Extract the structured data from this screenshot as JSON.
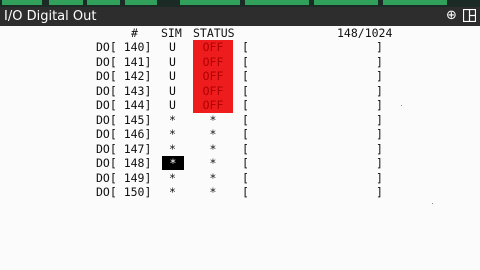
{
  "window": {
    "title": "I/O Digital Out"
  },
  "header": {
    "col_num": "#",
    "col_sim": "SIM",
    "col_status": "STATUS",
    "position": "148/1024"
  },
  "rows": [
    {
      "label": "DO[ 140]",
      "sim": "U",
      "status": "OFF",
      "lb": "[",
      "rb": "]"
    },
    {
      "label": "DO[ 141]",
      "sim": "U",
      "status": "OFF",
      "lb": "[",
      "rb": "]"
    },
    {
      "label": "DO[ 142]",
      "sim": "U",
      "status": "OFF",
      "lb": "[",
      "rb": "]"
    },
    {
      "label": "DO[ 143]",
      "sim": "U",
      "status": "OFF",
      "lb": "[",
      "rb": "]"
    },
    {
      "label": "DO[ 144]",
      "sim": "U",
      "status": "OFF",
      "lb": "[",
      "rb": "]"
    },
    {
      "label": "DO[ 145]",
      "sim": "*",
      "status": "*",
      "lb": "[",
      "rb": "]"
    },
    {
      "label": "DO[ 146]",
      "sim": "*",
      "status": "*",
      "lb": "[",
      "rb": "]"
    },
    {
      "label": "DO[ 147]",
      "sim": "*",
      "status": "*",
      "lb": "[",
      "rb": "]"
    },
    {
      "label": "DO[ 148]",
      "sim": "*",
      "status": "*",
      "lb": "[",
      "rb": "]"
    },
    {
      "label": "DO[ 149]",
      "sim": "*",
      "status": "*",
      "lb": "[",
      "rb": "]"
    },
    {
      "label": "DO[ 150]",
      "sim": "*",
      "status": "*",
      "lb": "[",
      "rb": "]"
    }
  ],
  "colors": {
    "off_bg": "#ee1c1c",
    "titlebar": "#2d2d2d",
    "selection": "#000000"
  },
  "icons": {
    "zoom": "zoom-in-icon",
    "layout": "window-layout-icon"
  }
}
